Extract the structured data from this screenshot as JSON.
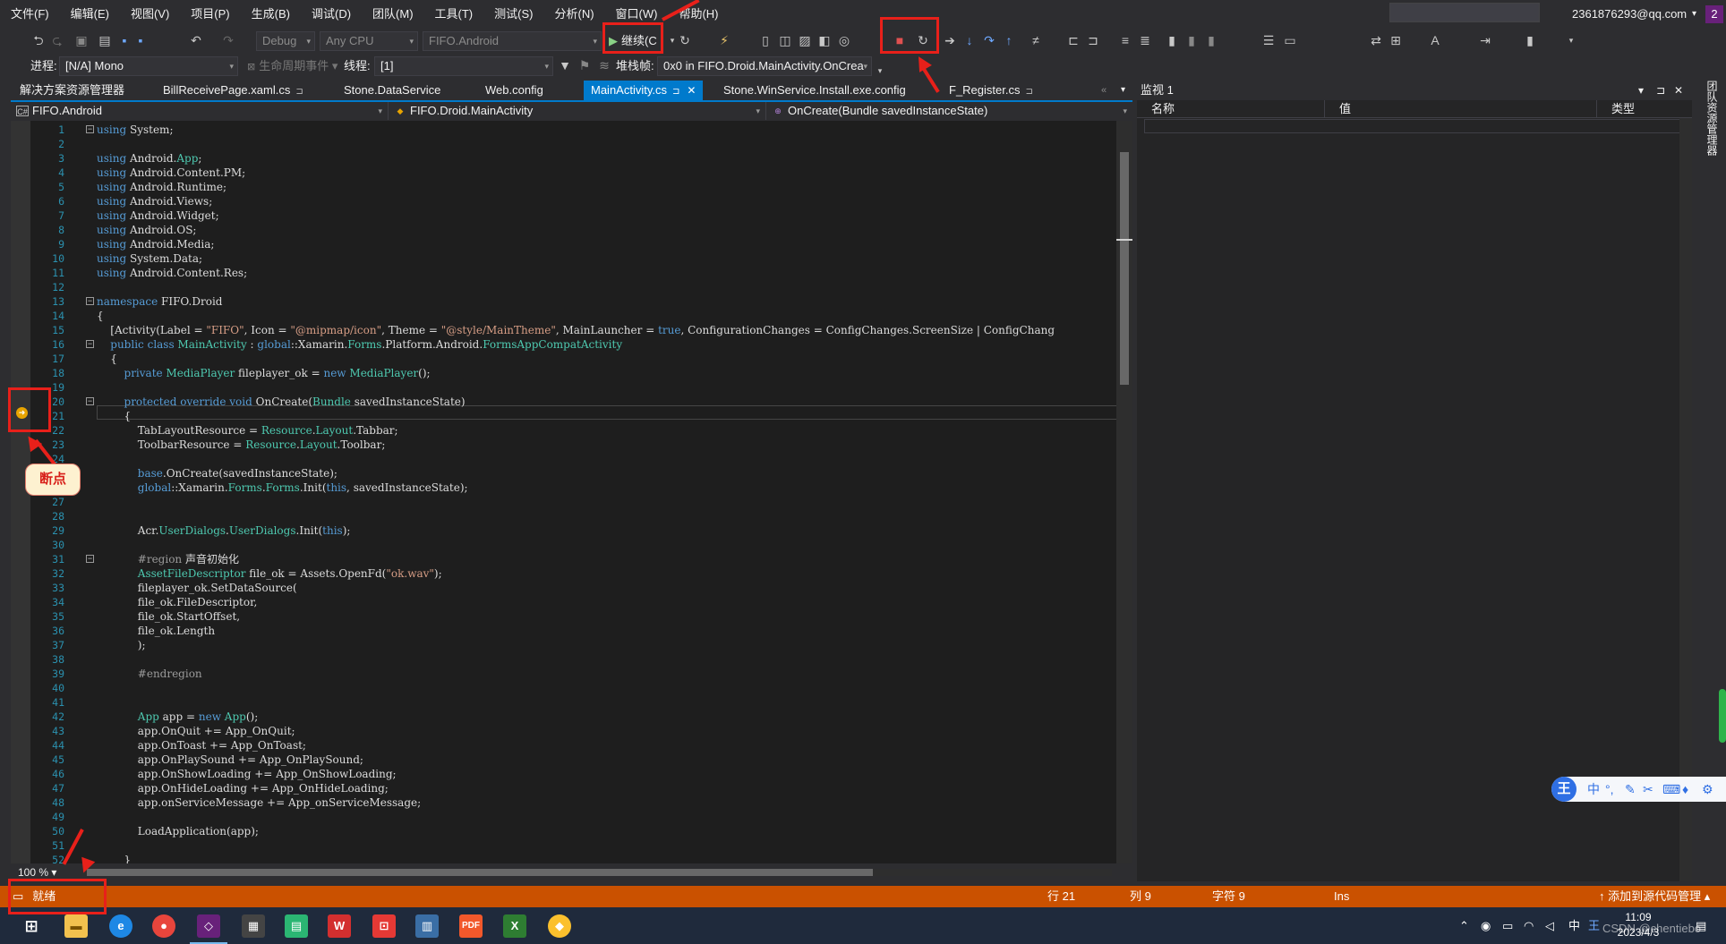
{
  "menu": [
    "文件(F)",
    "编辑(E)",
    "视图(V)",
    "项目(P)",
    "生成(B)",
    "调试(D)",
    "团队(M)",
    "工具(T)",
    "测试(S)",
    "分析(N)",
    "窗口(W)",
    "帮助(H)"
  ],
  "account": "2361876293@qq.com",
  "profile_badge": "2",
  "toolbar1": {
    "config": "Debug",
    "platform": "Any CPU",
    "project": "FIFO.Android",
    "continue_label": "继续(C"
  },
  "toolbar2": {
    "process_label": "进程:",
    "process_value": "[N/A] Mono",
    "lifecycle_label": "生命周期事件",
    "thread_label": "线程:",
    "thread_value": "[1]",
    "stack_label": "堆栈帧:",
    "stack_value": "0x0 in FIFO.Droid.MainActivity.OnCrea"
  },
  "tabs": [
    {
      "label": "解决方案资源管理器",
      "pin": ""
    },
    {
      "label": "BillReceivePage.xaml.cs",
      "pin": "⊐"
    },
    {
      "label": "Stone.DataService",
      "pin": ""
    },
    {
      "label": "Web.config",
      "pin": ""
    },
    {
      "label": "MainActivity.cs",
      "pin": "⊐"
    },
    {
      "label": "Stone.WinService.Install.exe.config",
      "pin": ""
    },
    {
      "label": "F_Register.cs",
      "pin": "⊐"
    }
  ],
  "nav": {
    "project": "FIFO.Android",
    "class": "FIFO.Droid.MainActivity",
    "member": "OnCreate(Bundle savedInstanceState)"
  },
  "code_lines": [
    "using System;",
    "",
    "using Android.App;",
    "using Android.Content.PM;",
    "using Android.Runtime;",
    "using Android.Views;",
    "using Android.Widget;",
    "using Android.OS;",
    "using Android.Media;",
    "using System.Data;",
    "using Android.Content.Res;",
    "",
    "namespace FIFO.Droid",
    "{",
    "    [Activity(Label = \"FIFO\", Icon = \"@mipmap/icon\", Theme = \"@style/MainTheme\", MainLauncher = true, ConfigurationChanges = ConfigChanges.ScreenSize | ConfigChang",
    "    public class MainActivity : global::Xamarin.Forms.Platform.Android.FormsAppCompatActivity",
    "    {",
    "        private MediaPlayer fileplayer_ok = new MediaPlayer();",
    "",
    "        protected override void OnCreate(Bundle savedInstanceState)",
    "        {",
    "            TabLayoutResource = Resource.Layout.Tabbar;",
    "            ToolbarResource = Resource.Layout.Toolbar;",
    "",
    "            base.OnCreate(savedInstanceState);",
    "            global::Xamarin.Forms.Forms.Init(this, savedInstanceState);",
    "",
    "",
    "            Acr.UserDialogs.UserDialogs.Init(this);",
    "",
    "            #region 声音初始化",
    "            AssetFileDescriptor file_ok = Assets.OpenFd(\"ok.wav\");",
    "            fileplayer_ok.SetDataSource(",
    "            file_ok.FileDescriptor,",
    "            file_ok.StartOffset,",
    "            file_ok.Length",
    "            );",
    "",
    "            #endregion",
    "",
    "",
    "            App app = new App();",
    "            app.OnQuit += App_OnQuit;",
    "            app.OnToast += App_OnToast;",
    "            app.OnPlaySound += App_OnPlaySound;",
    "            app.OnShowLoading += App_OnShowLoading;",
    "            app.OnHideLoading += App_OnHideLoading;",
    "            app.onServiceMessage += App_onServiceMessage;",
    "",
    "            LoadApplication(app);",
    "",
    "        }"
  ],
  "zoom": "100 %",
  "watch": {
    "title": "监视 1",
    "col_name": "名称",
    "col_value": "值",
    "col_type": "类型"
  },
  "right_tab": "团队资源管理器",
  "callout": "断点",
  "status": {
    "ready": "就绪",
    "line": "行 21",
    "col": "列 9",
    "char": "字符 9",
    "ins": "Ins",
    "source_control": "添加到源代码管理"
  },
  "clock": {
    "time": "11:09",
    "date": "2023/4/3"
  },
  "watermark": "CSDN @chentiebo",
  "ime_cn": "中",
  "ime_logo": "王",
  "colors": {
    "accent": "#007acc",
    "status": "#ca5100",
    "annotation": "#e8201a"
  }
}
